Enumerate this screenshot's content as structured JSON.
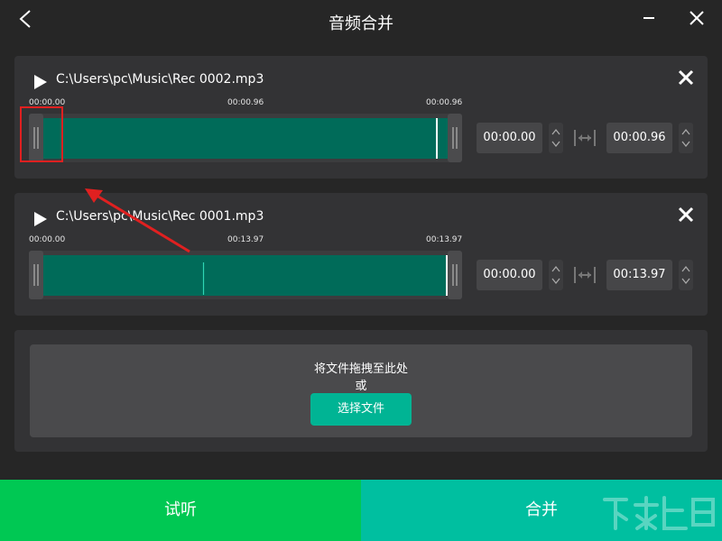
{
  "window": {
    "title": "音频合并",
    "back_icon": "chevron-left-icon",
    "minimize_icon": "minimize-icon",
    "close_icon": "close-icon"
  },
  "tracks": [
    {
      "file_path": "C:\\Users\\pc\\Music\\Rec 0002.mp3",
      "ticks": [
        "00:00.00",
        "00:00.96",
        "00:00.96"
      ],
      "start_time": "00:00.00",
      "end_time": "00:00.96"
    },
    {
      "file_path": "C:\\Users\\pc\\Music\\Rec 0001.mp3",
      "ticks": [
        "00:00.00",
        "00:13.97",
        "00:13.97"
      ],
      "start_time": "00:00.00",
      "end_time": "00:13.97"
    }
  ],
  "dropzone": {
    "hint": "将文件拖拽至此处",
    "or": "或",
    "choose_button": "选择文件"
  },
  "footer": {
    "preview_button": "试听",
    "merge_button": "合并"
  },
  "colors": {
    "waveform": "#006b59",
    "preview": "#00c853",
    "merge": "#00bfa0",
    "annotation": "#e02020"
  }
}
